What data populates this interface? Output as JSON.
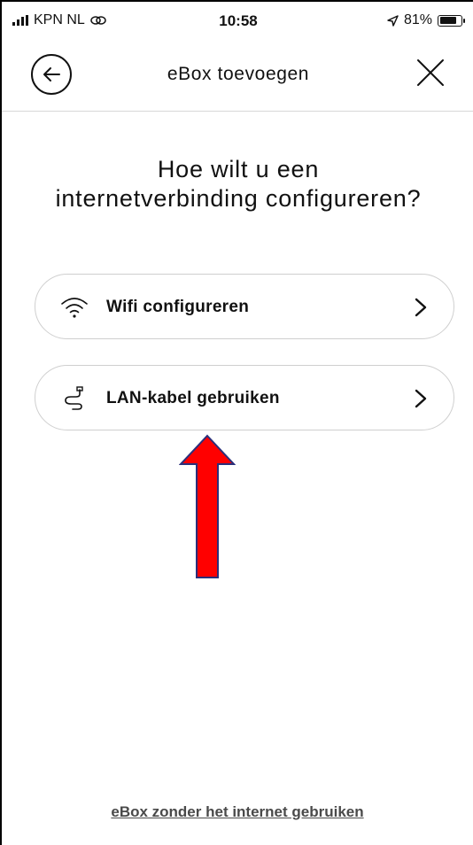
{
  "status_bar": {
    "carrier": "KPN NL",
    "time": "10:58",
    "battery_text": "81%",
    "battery_level": 0.81
  },
  "header": {
    "title": "eBox toevoegen"
  },
  "question": "Hoe wilt u een internetverbinding configureren?",
  "options": [
    {
      "label": "Wifi configureren",
      "icon": "wifi-icon"
    },
    {
      "label": "LAN-kabel gebruiken",
      "icon": "cable-icon"
    }
  ],
  "bottom_link": "eBox zonder het internet gebruiken",
  "colors": {
    "annotation_arrow": "#ff0000",
    "annotation_outline": "#2b2f7a",
    "link_gray": "#4a4a4a",
    "pill_border": "#cfcfcf"
  }
}
